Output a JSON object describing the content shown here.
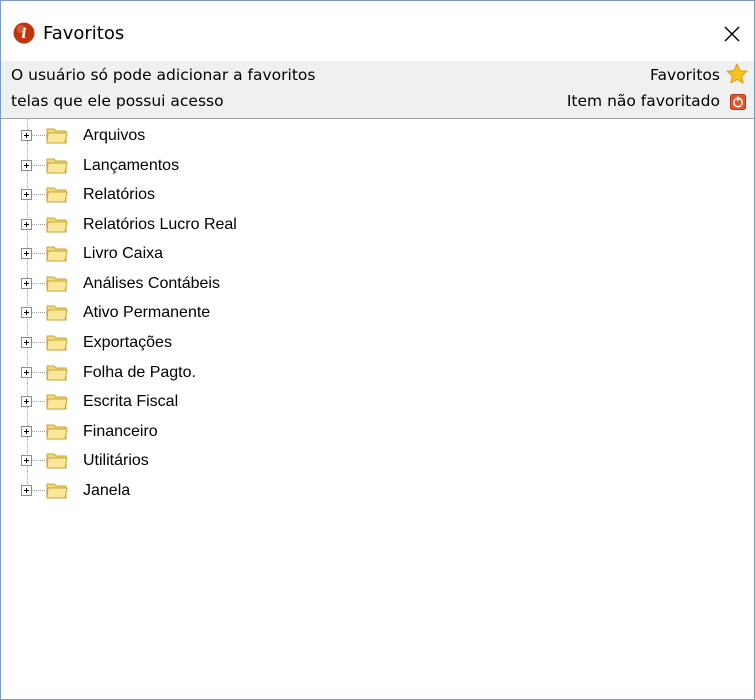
{
  "window": {
    "title": "Favoritos",
    "close_symbol": "✕",
    "app_icon": "info-icon",
    "close_icon": "close-icon"
  },
  "info": {
    "line1": "O usuário só pode adicionar a favoritos",
    "line2": "telas que ele possui acesso",
    "legend_favorites": "Favoritos",
    "legend_not_favorited": "Item não favoritado",
    "favorites_icon": "star-icon",
    "not_favorited_icon": "not-favorited-icon"
  },
  "tree": {
    "items": [
      {
        "label": "Arquivos"
      },
      {
        "label": "Lançamentos"
      },
      {
        "label": "Relatórios"
      },
      {
        "label": "Relatórios Lucro Real"
      },
      {
        "label": "Livro Caixa"
      },
      {
        "label": "Análises Contábeis"
      },
      {
        "label": "Ativo Permanente"
      },
      {
        "label": "Exportações"
      },
      {
        "label": "Folha de Pagto."
      },
      {
        "label": "Escrita Fiscal"
      },
      {
        "label": "Financeiro"
      },
      {
        "label": "Utilitários"
      },
      {
        "label": "Janela"
      }
    ]
  },
  "colors": {
    "window_border": "#7a9cc8",
    "info_background": "#f0f0f0",
    "app_icon": "#c0360c",
    "folder": "#f5d774",
    "star": "#f7c21b",
    "not_favorited": "#e8542a"
  }
}
